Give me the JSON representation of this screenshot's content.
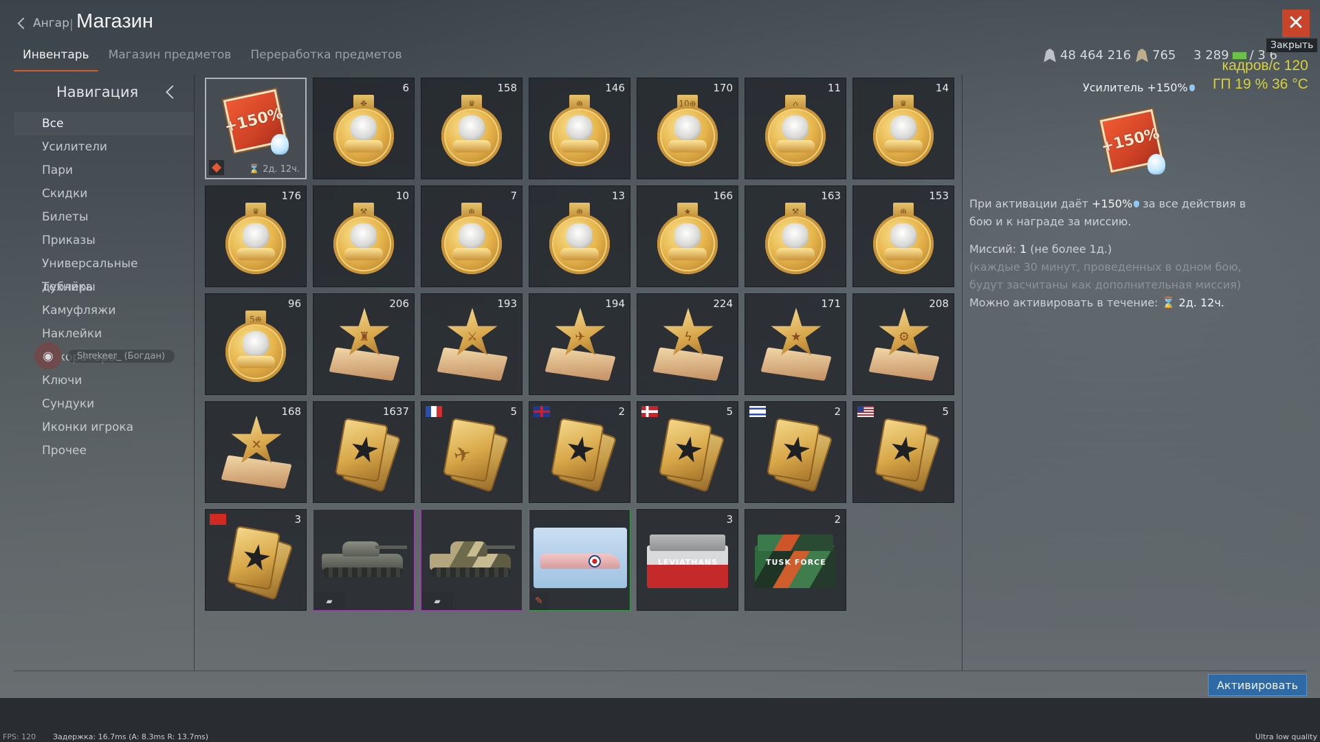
{
  "header": {
    "back_label": "Ангар",
    "separator": "|",
    "title": "Магазин",
    "tabs": [
      {
        "label": "Инвентарь"
      },
      {
        "label": "Магазин предметов"
      },
      {
        "label": "Переработка предметов"
      }
    ],
    "silver_lions": "48 464 216",
    "warbonds": "765",
    "golden_eagles": "3 289",
    "ge_slash": "/ 3 6",
    "close_tooltip": "Закрыть",
    "fps_overlay": {
      "line1": "кадров/с  120",
      "line2": "ГП  19 %  36 °C"
    }
  },
  "nav": {
    "title": "Навигация",
    "items": [
      {
        "label": "Все"
      },
      {
        "label": "Усилители"
      },
      {
        "label": "Пари"
      },
      {
        "label": "Скидки"
      },
      {
        "label": "Билеты"
      },
      {
        "label": "Приказы"
      },
      {
        "label": "Универсальные дублёры"
      },
      {
        "label": "Техника"
      },
      {
        "label": "Камуфляжи"
      },
      {
        "label": "Наклейки"
      },
      {
        "label": "Декораторы"
      },
      {
        "label": "Ключи"
      },
      {
        "label": "Сундуки"
      },
      {
        "label": "Иконки игрока"
      },
      {
        "label": "Прочее"
      }
    ],
    "discord_user": "Shrekeer_ (Богдан)"
  },
  "grid": {
    "booster": {
      "pct": "+150%",
      "timer": "⌛ 2д. 12ч."
    },
    "medal_counts": [
      "6",
      "158",
      "146",
      "170",
      "11",
      "14",
      "176",
      "10",
      "7",
      "13",
      "166",
      "163",
      "153",
      "96"
    ],
    "medal_tabs": [
      "✥",
      "♛",
      "⊕",
      "10⊕",
      "⌂",
      "♛",
      "♛",
      "⚒",
      "⊕",
      "⊕",
      "★",
      "⚒",
      "⊕",
      "5⊕"
    ],
    "star_counts": [
      "206",
      "193",
      "194",
      "224",
      "171",
      "208",
      "168"
    ],
    "star_emblems": [
      "♜",
      "⚔",
      "✈",
      "ϟ",
      "★",
      "⚙",
      "✕"
    ],
    "card_counts": [
      "1637",
      "5",
      "2",
      "5",
      "2",
      "5",
      "3"
    ],
    "card_flags": [
      "",
      "fr",
      "uk",
      "no",
      "il",
      "us",
      "cn"
    ],
    "chest_counts": [
      "3",
      "2"
    ],
    "chest_labels": [
      "LEVIATHANS",
      "TUSK FORCE"
    ]
  },
  "detail": {
    "title": "Усилитель +150%",
    "icon_pct": "+150%",
    "line1_a": "При активации даёт",
    "line1_b": "+150%",
    "line1_c": "за все действия в бою и к награде за миссию.",
    "missions_label": "Миссий:",
    "missions_value": "1",
    "missions_note": "(не более 1д.)",
    "missions_hint": "(каждые 30 минут, проведенных в одном бою, будут засчитаны как дополнительная миссия)",
    "activate_within": "Можно активировать в течение:",
    "activate_time": "⌛ 2д. 12ч."
  },
  "footer": {
    "activate_label": "Активировать",
    "fps": "FPS: 120",
    "latency": "Задержка: 16.7ms (A: 8.3ms R: 13.7ms)",
    "quality": "Ultra low quality"
  }
}
